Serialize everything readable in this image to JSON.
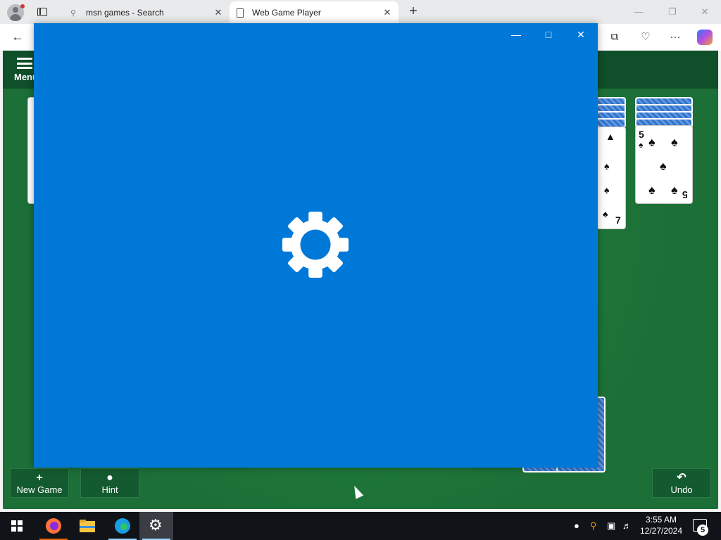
{
  "browser": {
    "tabs": [
      {
        "title": "msn games - Search",
        "favicon": "search-icon"
      },
      {
        "title": "Web Game Player",
        "favicon": "document-icon"
      }
    ],
    "new_tab_icon": "+",
    "minimize_icon": "—",
    "restore_icon": "❐",
    "close_icon": "✕",
    "back_icon": "←",
    "toolbar_icons": [
      "collections-icon",
      "browser-essentials-icon",
      "more-icon",
      "copilot-icon"
    ],
    "more_glyph": "···"
  },
  "game": {
    "menu_label": "Menu",
    "buttons": {
      "new_game": "New Game",
      "hint": "Hint",
      "undo": "Undo"
    },
    "visible_cards": [
      {
        "rank": "7",
        "suit": "spades"
      },
      {
        "rank": "5",
        "suit": "spades"
      }
    ],
    "felt_color": "#1e7a3c"
  },
  "settings_window": {
    "background": "#0078d7",
    "loading_icon": "gear-icon"
  },
  "taskbar": {
    "apps": [
      "firefox-icon",
      "file-explorer-icon",
      "edge-icon",
      "settings-icon"
    ],
    "time": "3:55 AM",
    "date": "12/27/2024",
    "notification_count": "5"
  }
}
